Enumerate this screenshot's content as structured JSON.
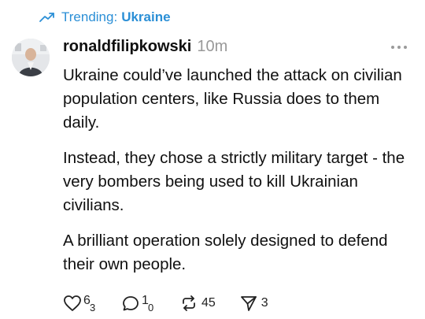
{
  "trending": {
    "prefix": "Trending:",
    "topic": "Ukraine",
    "icon": "trending-up-icon"
  },
  "post": {
    "username": "ronaldfilipkowski",
    "time": "10m",
    "paragraphs": [
      "Ukraine could’ve launched the attack on civilian population centers, like Russia does to them daily.",
      "Instead, they chose a strictly military target - the very bombers being used to kill Ukrainian civilians.",
      "A brilliant operation solely designed to defend their own people."
    ]
  },
  "actions": {
    "like": {
      "icon": "heart-icon",
      "count_top": "6",
      "count_bottom": "3"
    },
    "reply": {
      "icon": "comment-icon",
      "count_top": "1",
      "count_bottom": "0"
    },
    "repost": {
      "icon": "repost-icon",
      "count": "45"
    },
    "share": {
      "icon": "send-icon",
      "count": "3"
    }
  },
  "colors": {
    "accent": "#2b8fd6",
    "text": "#101010",
    "muted": "#999999"
  }
}
